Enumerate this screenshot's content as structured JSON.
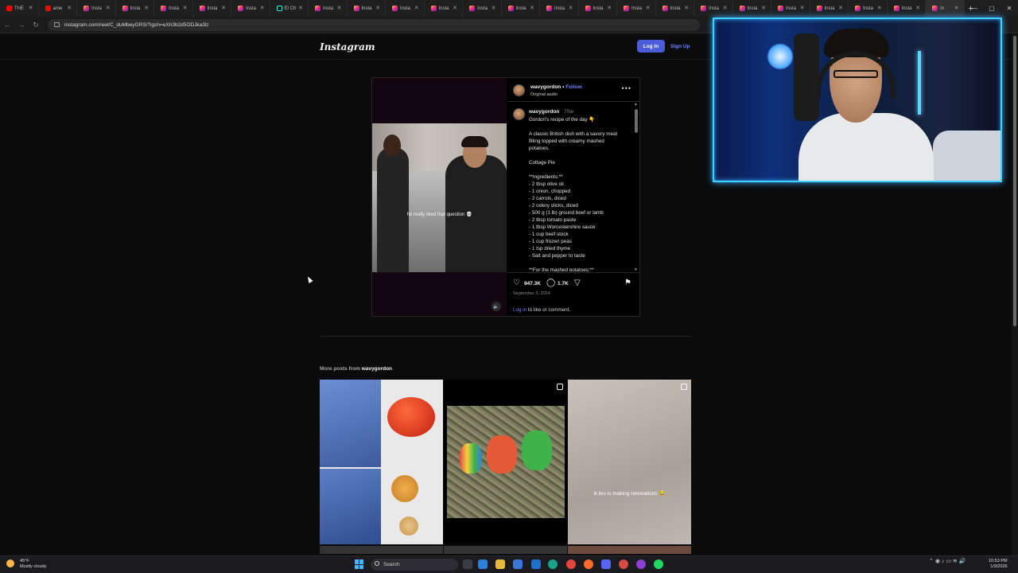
{
  "browser": {
    "tabs": [
      {
        "label": "THE",
        "icon": "youtube-icon",
        "active": false
      },
      {
        "label": "ame",
        "icon": "youtube-icon",
        "active": false
      },
      {
        "label": "Insta",
        "icon": "instagram-icon",
        "active": false
      },
      {
        "label": "Insta",
        "icon": "instagram-icon",
        "active": false
      },
      {
        "label": "Insta",
        "icon": "instagram-icon",
        "active": false
      },
      {
        "label": "Insta",
        "icon": "instagram-icon",
        "active": false
      },
      {
        "label": "Insta",
        "icon": "instagram-icon",
        "active": false
      },
      {
        "label": "El Ch",
        "icon": "tiktok-icon",
        "active": false
      },
      {
        "label": "Insta",
        "icon": "instagram-icon",
        "active": false
      },
      {
        "label": "Insta",
        "icon": "instagram-icon",
        "active": false
      },
      {
        "label": "Insta",
        "icon": "instagram-icon",
        "active": false
      },
      {
        "label": "Insta",
        "icon": "instagram-icon",
        "active": false
      },
      {
        "label": "Insta",
        "icon": "instagram-icon",
        "active": false
      },
      {
        "label": "Insta",
        "icon": "instagram-icon",
        "active": false
      },
      {
        "label": "Insta",
        "icon": "instagram-icon",
        "active": false
      },
      {
        "label": "Insta",
        "icon": "instagram-icon",
        "active": false
      },
      {
        "label": "Insta",
        "icon": "instagram-icon",
        "active": false
      },
      {
        "label": "Insta",
        "icon": "instagram-icon",
        "active": false
      },
      {
        "label": "Insta",
        "icon": "instagram-icon",
        "active": false
      },
      {
        "label": "Insta",
        "icon": "instagram-icon",
        "active": false
      },
      {
        "label": "Insta",
        "icon": "instagram-icon",
        "active": false
      },
      {
        "label": "Insta",
        "icon": "instagram-icon",
        "active": false
      },
      {
        "label": "Insta",
        "icon": "instagram-icon",
        "active": false
      },
      {
        "label": "Insta",
        "icon": "instagram-icon",
        "active": false
      },
      {
        "label": "In",
        "icon": "instagram-icon",
        "active": true
      }
    ],
    "url": "instagram.com/reel/C_duMbeyGRS/?igsh=eXh3b2d5ODJka3lz"
  },
  "instagram": {
    "logo": "Instagram",
    "login": "Log In",
    "signup": "Sign Up",
    "post": {
      "username": "wavygordon",
      "separator": "•",
      "follow": "Follow",
      "audio": "Original audio",
      "video_caption": "he really liked that question 💀",
      "comment_user": "wavygordon",
      "comment_age": "70w",
      "caption_lines": [
        "Gordon's recipe of the day 👇",
        "",
        "A classic British dish with a savory meat",
        "filling topped with creamy mashed",
        "potatoes.",
        "",
        "Cottage Pie",
        "",
        "**Ingredients:**",
        "- 2 tbsp olive oil",
        "- 1 onion, chopped",
        "- 2 carrots, diced",
        "- 2 celery sticks, diced",
        "- 500 g (1 lb) ground beef or lamb",
        "- 2 tbsp tomato paste",
        "- 1 tbsp Worcestershire sauce",
        "- 1 cup beef stock",
        "- 1 cup frozen peas",
        "- 1 tsp dried thyme",
        "- Salt and pepper to taste",
        "",
        "**For the mashed potatoes:**"
      ],
      "likes": "947.3K",
      "comments": "1.7K",
      "date": "September 3, 2024",
      "login_link": "Log in",
      "login_rest": " to like or comment."
    },
    "more_prefix": "More posts from ",
    "more_user": "wavygordon",
    "grid": [
      {
        "caption": ""
      },
      {
        "caption": ""
      },
      {
        "caption": "lil bro is making renovations 😂"
      }
    ]
  },
  "taskbar": {
    "temp": "45°F",
    "weather": "Mostly cloudy",
    "search": "Search",
    "time": "10:53 PM",
    "date": "1/9/2026"
  }
}
